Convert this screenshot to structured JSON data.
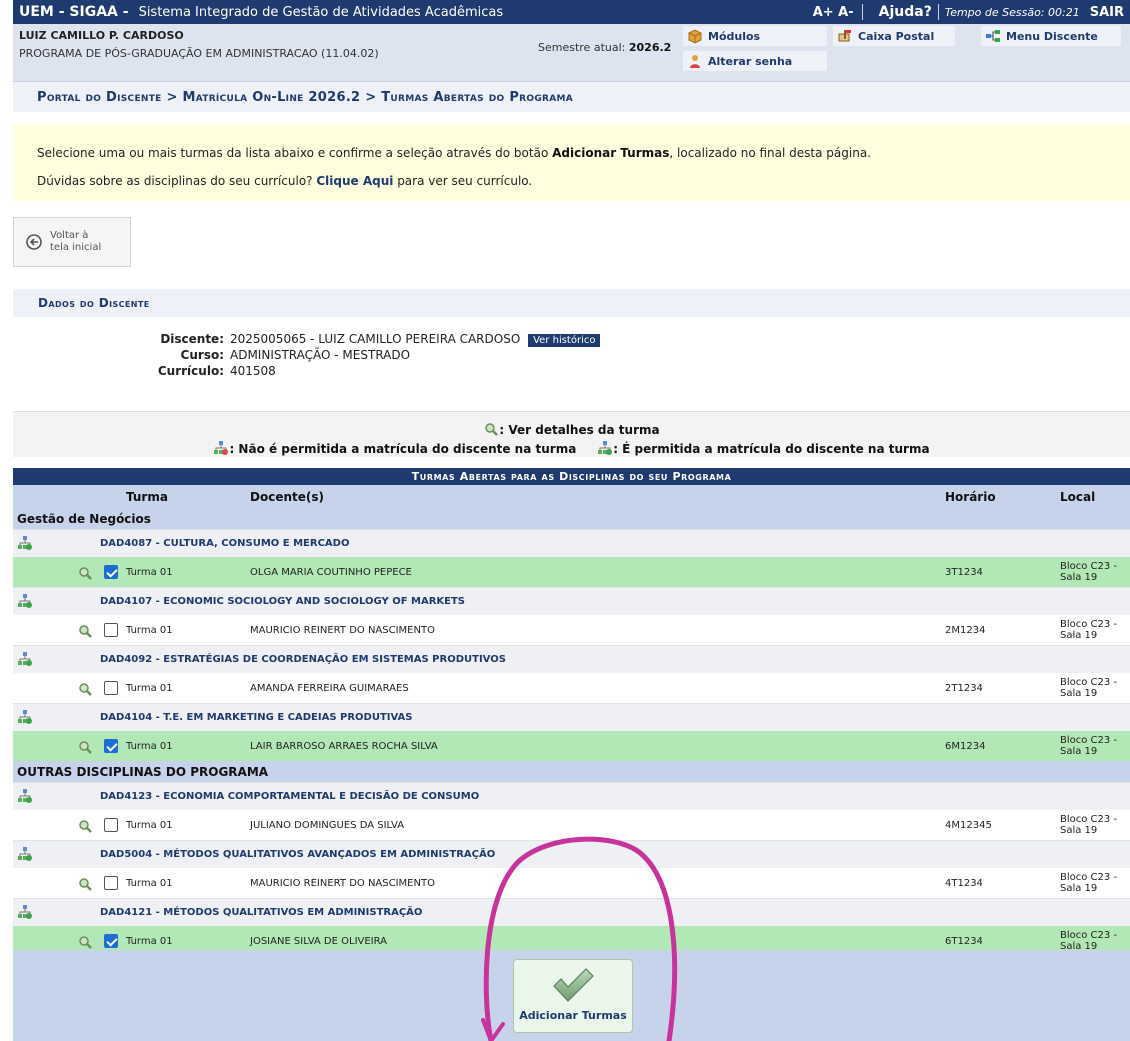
{
  "header": {
    "brand": "UEM - SIGAA -",
    "system": "Sistema Integrado de Gestão de Atividades Acadêmicas",
    "font_controls": "A+ A-",
    "help": "Ajuda?",
    "session": "Tempo de Sessão: 00:21",
    "exit": "SAIR"
  },
  "user": {
    "name": "LUIZ CAMILLO P. CARDOSO",
    "program": "PROGRAMA DE PÓS-GRADUAÇÃO EM ADMINISTRACAO (11.04.02)",
    "semester_label": "Semestre atual:",
    "semester_value": "2026.2",
    "modules": "Módulos",
    "mailbox": "Caixa Postal",
    "menu": "Menu Discente",
    "change_password": "Alterar senha"
  },
  "breadcrumb": "Portal do Discente > Matrícula On-Line 2026.2 > Turmas Abertas do Programa",
  "notice": {
    "line1_pre": "Selecione uma ou mais turmas da lista abaixo e confirme a seleção através do botão ",
    "line1_bold": "Adicionar Turmas",
    "line1_post": ", localizado no final desta página.",
    "line2_pre": "Dúvidas sobre as disciplinas do seu currículo? ",
    "line2_link": "Clique Aqui",
    "line2_post": " para ver seu currículo."
  },
  "back": {
    "line1": "Voltar à",
    "line2": "tela inicial"
  },
  "student": {
    "section_title": "Dados do Discente",
    "discente_label": "Discente:",
    "discente_value": "2025005065 - LUIZ CAMILLO PEREIRA CARDOSO",
    "history": "Ver histórico",
    "curso_label": "Curso:",
    "curso_value": "ADMINISTRAÇÃO - MESTRADO",
    "curriculo_label": "Currículo:",
    "curriculo_value": "401508"
  },
  "legend": {
    "details": ": Ver detalhes da turma",
    "not_allowed": ": Não é permitida a matrícula do discente na turma",
    "allowed": ": É permitida a matrícula do discente na turma"
  },
  "table": {
    "title": "Turmas Abertas para as Disciplinas do seu Programa",
    "columns": {
      "turma": "Turma",
      "docente": "Docente(s)",
      "horario": "Horário",
      "local": "Local"
    }
  },
  "groups": [
    {
      "name": "Gestão de Negócios",
      "disciplines": [
        {
          "name": "DAD4087 - CULTURA, CONSUMO E MERCADO",
          "turma": "Turma 01",
          "docente": "OLGA MARIA COUTINHO PEPECE",
          "horario": "3T1234",
          "local": "Bloco C23 - Sala 19",
          "selected": true
        },
        {
          "name": "DAD4107 - ECONOMIC SOCIOLOGY AND SOCIOLOGY OF MARKETS",
          "turma": "Turma 01",
          "docente": "MAURICIO REINERT DO NASCIMENTO",
          "horario": "2M1234",
          "local": "Bloco C23 - Sala 19",
          "selected": false
        },
        {
          "name": "DAD4092 - ESTRATÉGIAS DE COORDENAÇÃO EM SISTEMAS PRODUTIVOS",
          "turma": "Turma 01",
          "docente": "AMANDA FERREIRA GUIMARAES",
          "horario": "2T1234",
          "local": "Bloco C23 - Sala 19",
          "selected": false
        },
        {
          "name": "DAD4104 - T.E. EM MARKETING E CADEIAS PRODUTIVAS",
          "turma": "Turma 01",
          "docente": "LAIR BARROSO ARRAES ROCHA SILVA",
          "horario": "6M1234",
          "local": "Bloco C23 - Sala 19",
          "selected": true
        }
      ]
    },
    {
      "name": "OUTRAS DISCIPLINAS DO PROGRAMA",
      "disciplines": [
        {
          "name": "DAD4123 - ECONOMIA COMPORTAMENTAL E DECISÃO DE CONSUMO",
          "turma": "Turma 01",
          "docente": "JULIANO DOMINGUES DA SILVA",
          "horario": "4M12345",
          "local": "Bloco C23 - Sala 19",
          "selected": false
        },
        {
          "name": "DAD5004 - MÉTODOS QUALITATIVOS AVANÇADOS EM ADMINISTRAÇÃO",
          "turma": "Turma 01",
          "docente": "MAURICIO REINERT DO NASCIMENTO",
          "horario": "4T1234",
          "local": "Bloco C23 - Sala 19",
          "selected": false
        },
        {
          "name": "DAD4121 - MÉTODOS QUALITATIVOS EM ADMINISTRAÇÃO",
          "turma": "Turma 01",
          "docente": "JOSIANE SILVA DE OLIVEIRA",
          "horario": "6T1234",
          "local": "Bloco C23 - Sala 19",
          "selected": true
        }
      ]
    }
  ],
  "add_button": "Adicionar Turmas",
  "colors": {
    "brand": "#1f3a6e",
    "selected_row": "#b2e8b5",
    "annotation": "#c8339b"
  }
}
